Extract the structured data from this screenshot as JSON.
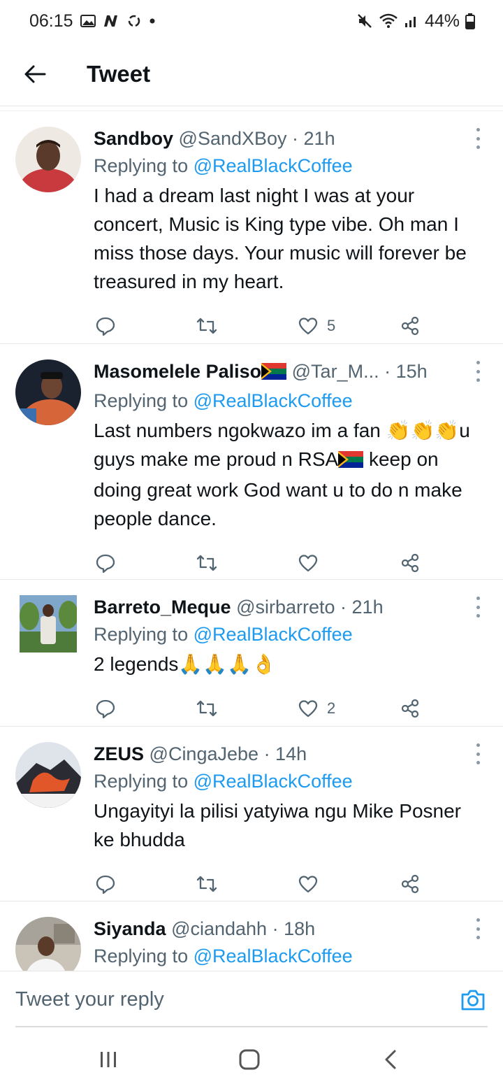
{
  "status_bar": {
    "time": "06:15",
    "battery": "44%",
    "icons_left": [
      "gallery-icon",
      "n-icon",
      "sync-icon",
      "dot-icon"
    ],
    "icons_right": [
      "mute-icon",
      "wifi-icon",
      "signal-icon",
      "battery-icon"
    ]
  },
  "header": {
    "title": "Tweet"
  },
  "colors": {
    "link": "#1d9bf0",
    "muted": "#536471",
    "text": "#0f1419"
  },
  "tweets": [
    {
      "name": "Sandboy",
      "handle": "@SandXBoy",
      "time": "· 21h",
      "replying_label": "Replying to",
      "replying_handle": "@RealBlackCoffee",
      "text": "I had a dream last night I was at your concert, Music is King type vibe. Oh man I miss those days. Your music will forever be treasured in my heart.",
      "likes": "5"
    },
    {
      "name": "Masomelele Paliso",
      "handle": "@Tar_M...",
      "time": "· 15h",
      "replying_label": "Replying to",
      "replying_handle": "@RealBlackCoffee",
      "text_part1": "Last numbers ngokwazo im a fan 👏👏👏u guys make me proud n RSA",
      "text_part2": " keep on doing great work God want u to do n make people dance.",
      "likes": ""
    },
    {
      "name": "Barreto_Meque",
      "handle": "@sirbarreto",
      "time": "· 21h",
      "replying_label": "Replying to",
      "replying_handle": "@RealBlackCoffee",
      "text": "2 legends🙏🙏🙏👌",
      "likes": "2"
    },
    {
      "name": "ZEUS",
      "handle": "@CingaJebe",
      "time": "· 14h",
      "replying_label": "Replying to",
      "replying_handle": "@RealBlackCoffee",
      "text": "Ungayityi la pilisi yatyiwa ngu Mike Posner ke bhudda",
      "likes": ""
    },
    {
      "name": "Siyanda",
      "handle": "@ciandahh",
      "time": "· 18h",
      "replying_label": "Replying to",
      "replying_handle": "@RealBlackCoffee"
    }
  ],
  "compose": {
    "placeholder": "Tweet your reply"
  },
  "navbar": {
    "buttons": [
      "recents-icon",
      "home-icon",
      "back-icon"
    ]
  }
}
